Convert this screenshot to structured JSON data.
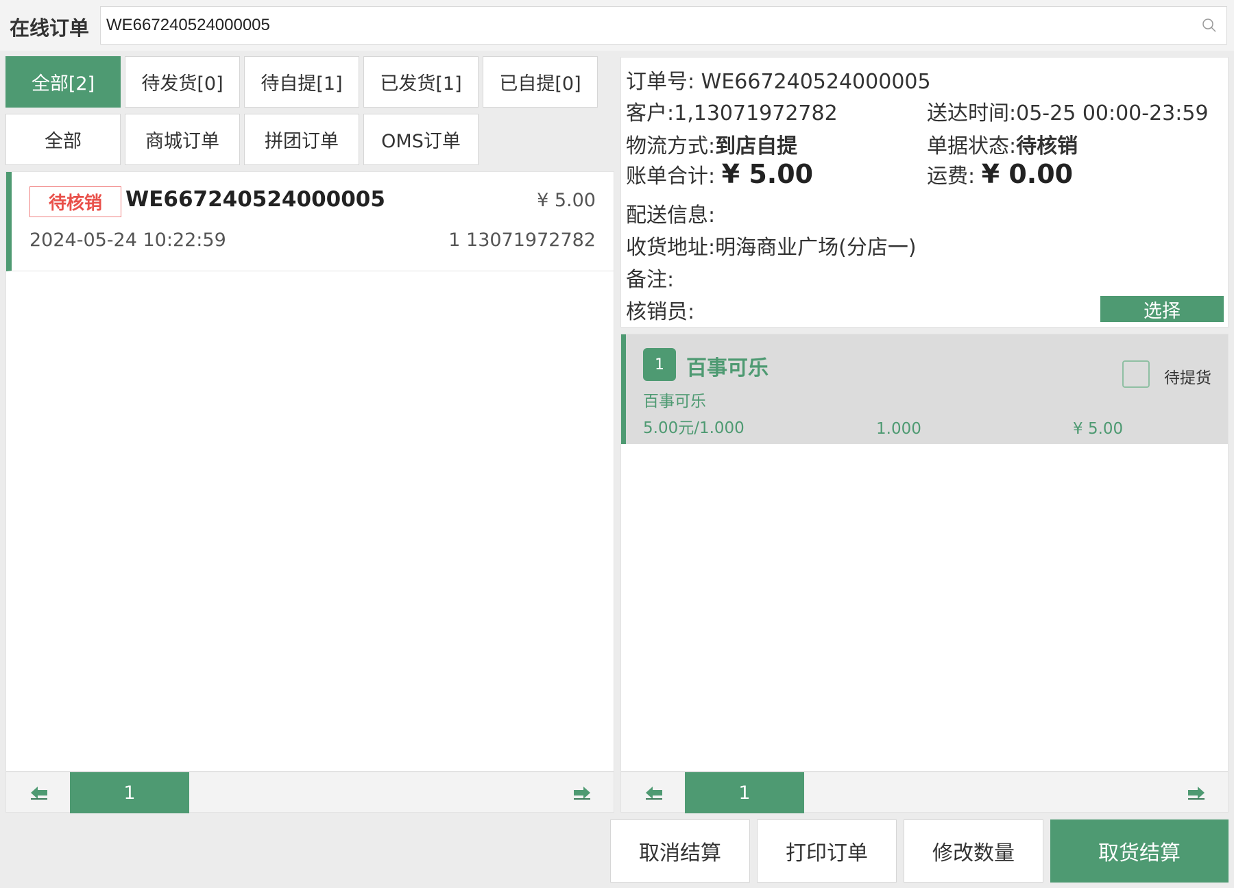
{
  "header": {
    "title": "在线订单",
    "search_value": "WE667240524000005"
  },
  "status_tabs": [
    {
      "label": "全部[2]",
      "active": true
    },
    {
      "label": "待发货[0]",
      "active": false
    },
    {
      "label": "待自提[1]",
      "active": false
    },
    {
      "label": "已发货[1]",
      "active": false
    },
    {
      "label": "已自提[0]",
      "active": false
    }
  ],
  "type_tabs": [
    {
      "label": "全部"
    },
    {
      "label": "商城订单"
    },
    {
      "label": "拼团订单"
    },
    {
      "label": "OMS订单"
    }
  ],
  "orders": [
    {
      "status": "待核销",
      "order_no": "WE667240524000005",
      "price": "¥ 5.00",
      "time": "2024-05-24 10:22:59",
      "customer": "1 13071972782"
    }
  ],
  "left_pager": {
    "page": "1"
  },
  "detail": {
    "order_no_label": "订单号:",
    "order_no": "WE667240524000005",
    "customer_label": "客户:",
    "customer": "1,13071972782",
    "delivery_time_label": "送达时间:",
    "delivery_time": "05-25 00:00-23:59",
    "logistics_label": "物流方式:",
    "logistics": "到店自提",
    "doc_status_label": "单据状态:",
    "doc_status": "待核销",
    "bill_total_label": "账单合计:",
    "bill_total": "¥ 5.00",
    "freight_label": "运费:",
    "freight": "¥ 0.00",
    "delivery_info_label": "配送信息:",
    "address_label": "收货地址:",
    "address": "明海商业广场(分店一)",
    "remark_label": "备注:",
    "verifier_label": "核销员:",
    "select_label": "选择"
  },
  "items": [
    {
      "index": "1",
      "name": "百事可乐",
      "sub_name": "百事可乐",
      "unit_price": "5.00元/1.000",
      "qty": "1.000",
      "amount": "¥ 5.00",
      "status": "待提货"
    }
  ],
  "right_pager": {
    "page": "1"
  },
  "actions": {
    "cancel": "取消结算",
    "print": "打印订单",
    "modify_qty": "修改数量",
    "pickup_checkout": "取货结算"
  },
  "colors": {
    "accent": "#4e9a72",
    "tag_red": "#e9504a"
  }
}
